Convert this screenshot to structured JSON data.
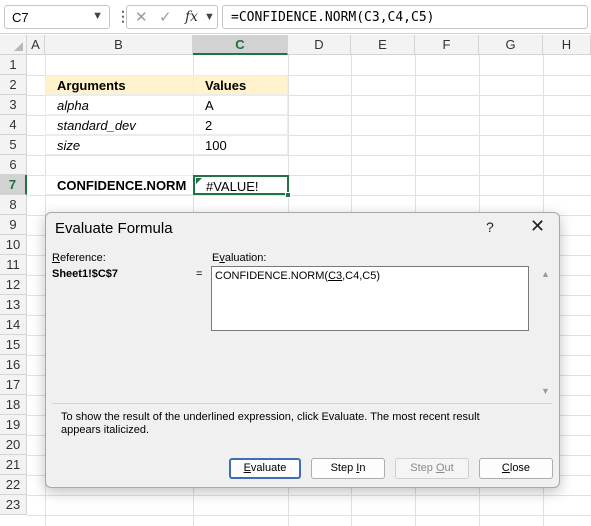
{
  "formula_bar": {
    "name_box": "C7",
    "formula": "=CONFIDENCE.NORM(C3,C4,C5)",
    "icons": [
      "cancel-x-icon",
      "confirm-check-icon",
      "insert-function-icon"
    ]
  },
  "columns": [
    "A",
    "B",
    "C",
    "D",
    "E",
    "F",
    "G",
    "H"
  ],
  "rows": [
    "1",
    "2",
    "3",
    "4",
    "5",
    "6",
    "7",
    "8",
    "9",
    "10",
    "11",
    "12",
    "13",
    "14",
    "15",
    "16",
    "17",
    "18",
    "19",
    "20",
    "21",
    "22",
    "23"
  ],
  "selected_cell": "C7",
  "table": {
    "headers": [
      "Arguments",
      "Values"
    ],
    "rows": [
      [
        "alpha",
        "A"
      ],
      [
        "standard_dev",
        "2"
      ],
      [
        "size",
        "100"
      ]
    ]
  },
  "result": {
    "label": "CONFIDENCE.NORM",
    "value": "#VALUE!"
  },
  "dialog": {
    "title": "Evaluate Formula",
    "help": "?",
    "close": "✕",
    "reference_label": "Reference:",
    "reference_value": "Sheet1!$C$7",
    "equals": "=",
    "evaluation_label": "Evaluation:",
    "evaluation": {
      "before": "CONFIDENCE.NORM(",
      "underlined": "C3",
      "after": ",C4,C5)"
    },
    "info": "To show the result of the underlined expression, click Evaluate.  The most recent result appears italicized.",
    "buttons": {
      "evaluate": "Evaluate",
      "step_in": "Step In",
      "step_out": "Step Out",
      "close": "Close"
    }
  },
  "colors": {
    "accent": "#217346",
    "table_header_fill": "#fff2cc"
  }
}
